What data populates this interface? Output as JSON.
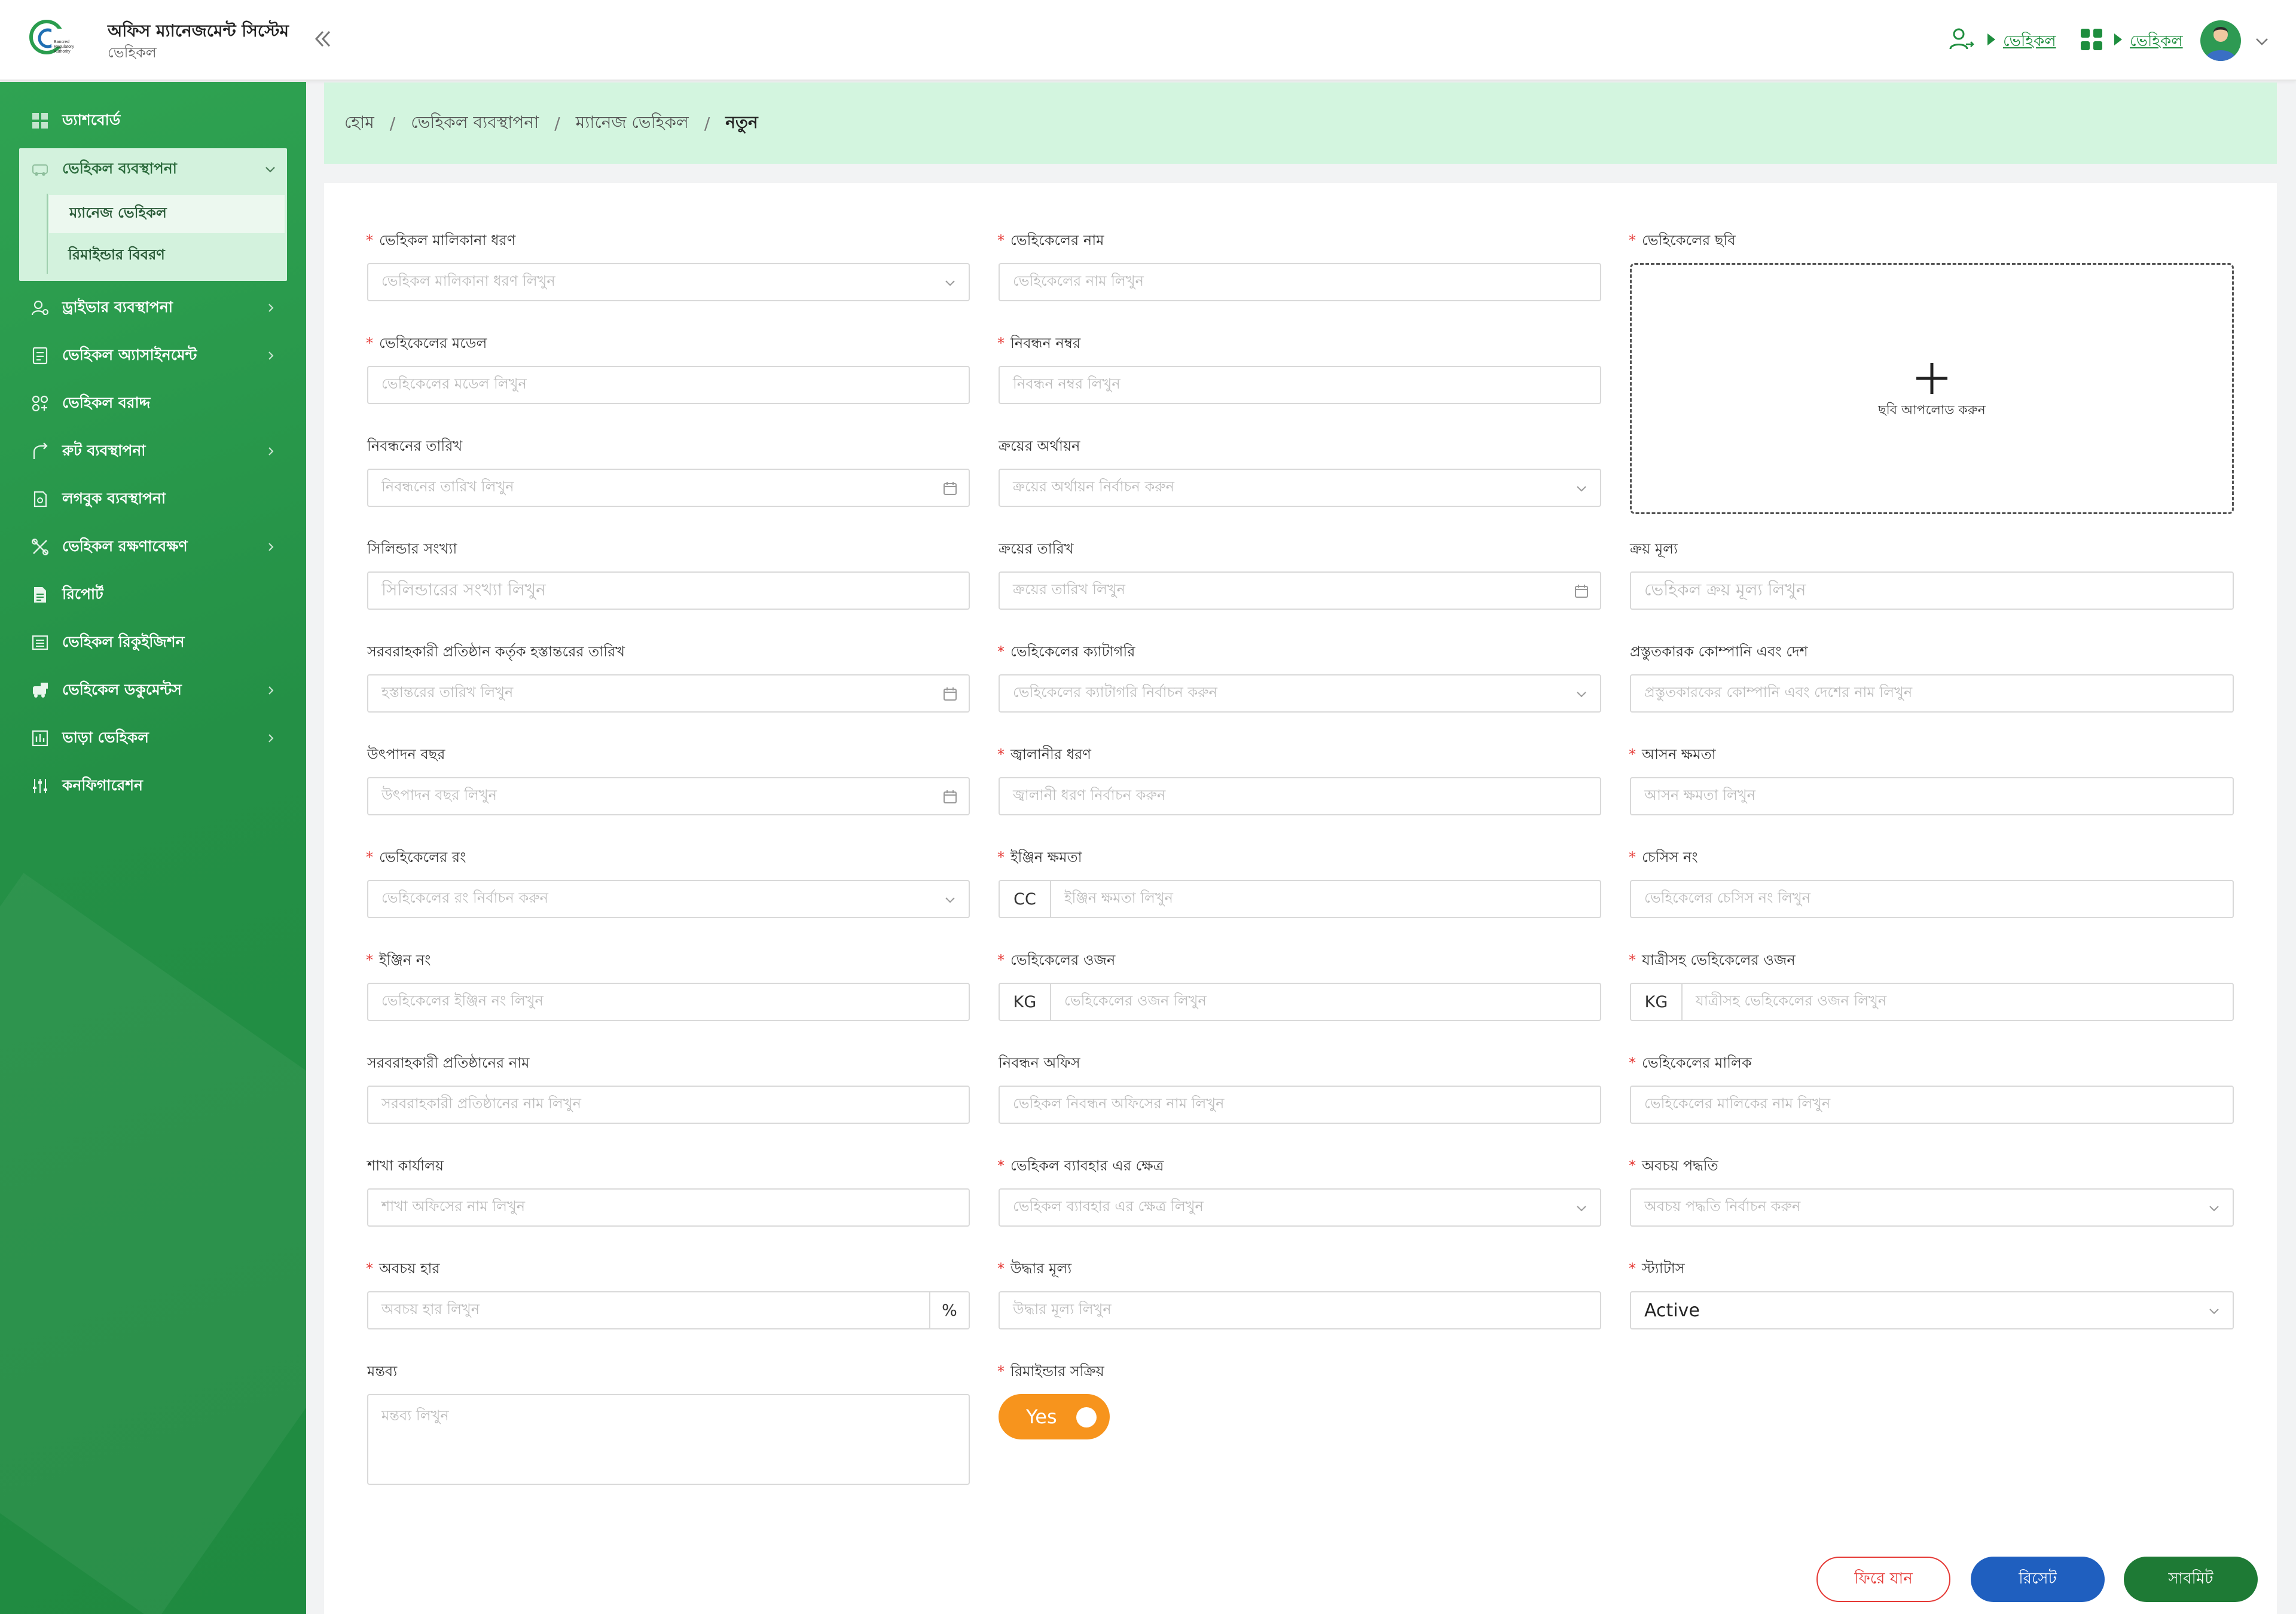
{
  "header": {
    "app_title": "অফিস ম্যানেজমেন্ট সিস্টেম",
    "app_subtitle": "ভেহিকল",
    "logo_text": "Bancred Regulatory Authority",
    "crumb_link_1": "ভেহিকল",
    "crumb_link_2": "ভেহিকল"
  },
  "sidebar": {
    "items": [
      {
        "label": "ড্যাশবোর্ড",
        "icon": "dashboard-icon"
      },
      {
        "label": "ভেহিকল ব্যবস্থাপনা",
        "icon": "vehicle-icon"
      },
      {
        "label": "ড্রাইভার ব্যবস্থাপনা",
        "icon": "driver-icon"
      },
      {
        "label": "ভেহিকল অ্যাসাইনমেন্ট",
        "icon": "assignment-icon"
      },
      {
        "label": "ভেহিকল বরাদ্দ",
        "icon": "allocation-icon"
      },
      {
        "label": "রুট ব্যবস্থাপনা",
        "icon": "route-icon"
      },
      {
        "label": "লগবুক ব্যবস্থাপনা",
        "icon": "logbook-icon"
      },
      {
        "label": "ভেহিকল রক্ষণাবেক্ষণ",
        "icon": "maintenance-icon"
      },
      {
        "label": "রিপোর্ট",
        "icon": "report-icon"
      },
      {
        "label": "ভেহিকল রিকুইজিশন",
        "icon": "requisition-icon"
      },
      {
        "label": "ভেহিকেল ডকুমেন্টস",
        "icon": "documents-icon"
      },
      {
        "label": "ভাড়া ভেহিকল",
        "icon": "rent-icon"
      },
      {
        "label": "কনফিগারেশন",
        "icon": "config-icon"
      }
    ],
    "sub_items": [
      "ম্যানেজ ভেহিকল",
      "রিমাইন্ডার বিবরণ"
    ]
  },
  "breadcrumb": [
    "হোম",
    "ভেহিকল ব্যবস্থাপনা",
    "ম্যানেজ ভেহিকল",
    "নতুন"
  ],
  "form": {
    "ownership_type": {
      "label": "ভেহিকল মালিকানা ধরণ",
      "placeholder": "ভেহিকল মালিকানা ধরণ লিখুন"
    },
    "vehicle_name": {
      "label": "ভেহিকেলের নাম",
      "placeholder": "ভেহিকেলের নাম লিখুন"
    },
    "vehicle_image": {
      "label": "ভেহিকেলের ছবি",
      "upload_text": "ছবি আপলোড করুন"
    },
    "vehicle_model": {
      "label": "ভেহিকেলের মডেল",
      "placeholder": "ভেহিকেলের মডেল লিখুন"
    },
    "registration_number": {
      "label": "নিবন্ধন নম্বর",
      "placeholder": "নিবন্ধন নম্বর লিখুন"
    },
    "registration_date": {
      "label": "নিবন্ধনের তারিখ",
      "placeholder": "নিবন্ধনের তারিখ লিখুন"
    },
    "purchase_funding": {
      "label": "ক্রয়ের অর্থায়ন",
      "placeholder": "ক্রয়ের অর্থায়ন নির্বাচন করুন"
    },
    "cylinder_count": {
      "label": "সিলিন্ডার সংখ্যা",
      "placeholder": "সিলিন্ডারের সংখ্যা লিখুন"
    },
    "purchase_date": {
      "label": "ক্রয়ের তারিখ",
      "placeholder": "ক্রয়ের তারিখ লিখুন"
    },
    "purchase_price": {
      "label": "ক্রয় মূল্য",
      "placeholder": "ভেহিকল ক্রয় মূল্য লিখুন"
    },
    "handover_date": {
      "label": "সরবরাহকারী প্রতিষ্ঠান কর্তৃক হস্তান্তরের তারিখ",
      "placeholder": "হস্তান্তরের তারিখ লিখুন"
    },
    "vehicle_category": {
      "label": "ভেহিকেলের ক্যাটাগরি",
      "placeholder": "ভেহিকেলের ক্যাটাগরি নির্বাচন করুন"
    },
    "manufacturer": {
      "label": "প্রস্তুতকারক কোম্পানি এবং দেশ",
      "placeholder": "প্রস্তুতকারকের কোম্পানি এবং দেশের নাম লিখুন"
    },
    "production_year": {
      "label": "উৎপাদন বছর",
      "placeholder": "উৎপাদন বছর লিখুন"
    },
    "fuel_type": {
      "label": "জ্বালানীর ধরণ",
      "placeholder": "জ্বালানী ধরণ নির্বাচন করুন"
    },
    "seat_capacity": {
      "label": "আসন ক্ষমতা",
      "placeholder": "আসন ক্ষমতা লিখুন"
    },
    "vehicle_color": {
      "label": "ভেহিকেলের রং",
      "placeholder": "ভেহিকেলের রং নির্বাচন করুন"
    },
    "engine_capacity": {
      "label": "ইঞ্জিন ক্ষমতা",
      "placeholder": "ইঞ্জিন ক্ষমতা লিখুন",
      "addon": "CC"
    },
    "chassis_no": {
      "label": "চেসিস নং",
      "placeholder": "ভেহিকেলের চেসিস নং লিখুন"
    },
    "engine_no": {
      "label": "ইঞ্জিন নং",
      "placeholder": "ভেহিকেলের ইঞ্জিন নং লিখুন"
    },
    "vehicle_weight": {
      "label": "ভেহিকেলের ওজন",
      "placeholder": "ভেহিকেলের ওজন লিখুন",
      "addon": "KG"
    },
    "weight_with_passenger": {
      "label": "যাত্রীসহ ভেহিকেলের ওজন",
      "placeholder": "যাত্রীসহ ভেহিকেলের ওজন লিখুন",
      "addon": "KG"
    },
    "supplier_name": {
      "label": "সরবরাহকারী প্রতিষ্ঠানের নাম",
      "placeholder": "সরবরাহকারী প্রতিষ্ঠানের নাম লিখুন"
    },
    "registration_office": {
      "label": "নিবন্ধন অফিস",
      "placeholder": "ভেহিকল নিবন্ধন অফিসের নাম লিখুন"
    },
    "vehicle_owner": {
      "label": "ভেহিকেলের মালিক",
      "placeholder": "ভেহিকেলের মালিকের নাম লিখুন"
    },
    "branch_office": {
      "label": "শাখা কার্যালয়",
      "placeholder": "শাখা অফিসের নাম লিখুন"
    },
    "usage_area": {
      "label": "ভেহিকল ব্যাবহার এর ক্ষেত্র",
      "placeholder": "ভেহিকল ব্যাবহার এর ক্ষেত্র লিখুন"
    },
    "depreciation_method": {
      "label": "অবচয় পদ্ধতি",
      "placeholder": "অবচয় পদ্ধতি নির্বাচন করুন"
    },
    "depreciation_rate": {
      "label": "অবচয় হার",
      "placeholder": "অবচয় হার লিখুন",
      "addon": "%"
    },
    "salvage_value": {
      "label": "উদ্ধার মূল্য",
      "placeholder": "উদ্ধার মূল্য লিখুন"
    },
    "status": {
      "label": "স্ট্যাটাস",
      "value": "Active"
    },
    "remarks": {
      "label": "মন্তব্য",
      "placeholder": "মন্তব্য লিখুন"
    },
    "reminder_active": {
      "label": "রিমাইন্ডার সক্রিয়",
      "value": "Yes"
    }
  },
  "buttons": {
    "back": "ফিরে যান",
    "reset": "রিসেট",
    "submit": "সাবমিট"
  },
  "colors": {
    "primary_green": "#249046",
    "breadcrumb_bg": "#d3f5df",
    "toggle_orange": "#f7941d",
    "reset_blue": "#1f5fbf",
    "submit_green": "#1e7a35",
    "back_red": "#e53935",
    "required": "#e53935"
  }
}
